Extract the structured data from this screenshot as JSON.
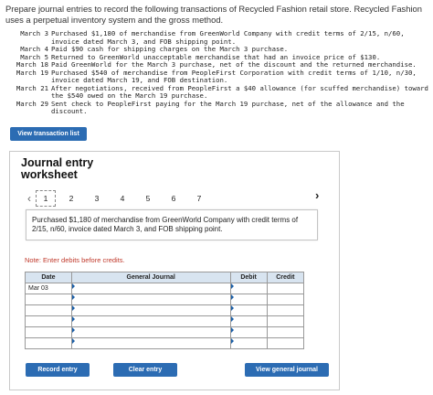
{
  "intro": "Prepare journal entries to record the following transactions of Recycled Fashion retail store. Recycled Fashion uses a perpetual inventory system and the gross method.",
  "transactions": [
    {
      "date": "March 3",
      "text": "Purchased $1,180 of merchandise from GreenWorld Company with credit terms of 2/15, n/60, invoice dated March 3, and FOB shipping point."
    },
    {
      "date": "March 4",
      "text": "Paid $90 cash for shipping charges on the March 3 purchase."
    },
    {
      "date": "March 5",
      "text": "Returned to GreenWorld unacceptable merchandise that had an invoice price of $130."
    },
    {
      "date": "March 18",
      "text": "Paid GreenWorld for the March 3 purchase, net of the discount and the returned merchandise."
    },
    {
      "date": "March 19",
      "text": "Purchased $540 of merchandise from PeopleFirst Corporation with credit terms of 1/10, n/30, invoice dated March 19, and FOB destination."
    },
    {
      "date": "March 21",
      "text": "After negotiations, received from PeopleFirst a $40 allowance (for scuffed merchandise) toward the $540 owed on the March 19 purchase."
    },
    {
      "date": "March 29",
      "text": "Sent check to PeopleFirst paying for the March 19 purchase, net of the allowance and the discount."
    }
  ],
  "view_transactions_label": "View transaction list",
  "worksheet": {
    "title": "Journal entry worksheet",
    "prev_arrow": "‹",
    "next_arrow": "›",
    "tabs": [
      "1",
      "2",
      "3",
      "4",
      "5",
      "6",
      "7"
    ],
    "active_tab": "1",
    "description": "Purchased $1,180 of merchandise from GreenWorld Company with credit terms of 2/15, n/60, invoice dated March 3, and FOB shipping point.",
    "note": "Note: Enter debits before credits.",
    "table": {
      "headers": {
        "date": "Date",
        "general_journal": "General Journal",
        "debit": "Debit",
        "credit": "Credit"
      },
      "rows": [
        {
          "date": "Mar 03",
          "account": "",
          "debit": "",
          "credit": ""
        },
        {
          "date": "",
          "account": "",
          "debit": "",
          "credit": ""
        },
        {
          "date": "",
          "account": "",
          "debit": "",
          "credit": ""
        },
        {
          "date": "",
          "account": "",
          "debit": "",
          "credit": ""
        },
        {
          "date": "",
          "account": "",
          "debit": "",
          "credit": ""
        },
        {
          "date": "",
          "account": "",
          "debit": "",
          "credit": ""
        }
      ]
    },
    "buttons": {
      "record": "Record entry",
      "clear": "Clear entry",
      "view_journal": "View general journal"
    }
  },
  "colors": {
    "button_blue": "#2c6cb3",
    "header_bg": "#d8e4f0",
    "note_red": "#c0392b",
    "marker_blue": "#1a5fa8"
  }
}
